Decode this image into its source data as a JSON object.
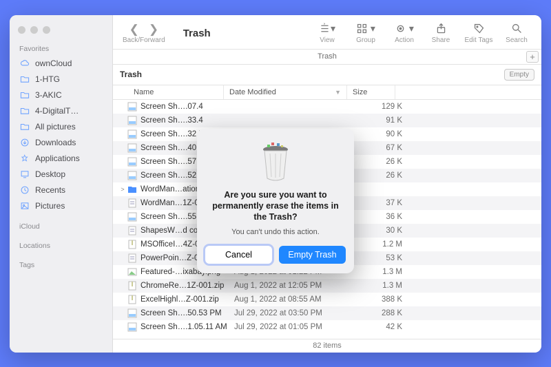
{
  "window": {
    "title": "Trash",
    "nav_label": "Back/Forward",
    "subheader": "Trash",
    "location": "Trash",
    "empty_button": "Empty",
    "status": "82 items",
    "plus": "+"
  },
  "toolbar": {
    "view": {
      "label": "View"
    },
    "group": {
      "label": "Group"
    },
    "action": {
      "label": "Action"
    },
    "share": {
      "label": "Share"
    },
    "tags": {
      "label": "Edit Tags"
    },
    "search": {
      "label": "Search"
    }
  },
  "sidebar": {
    "favorites_label": "Favorites",
    "icloud_label": "iCloud",
    "locations_label": "Locations",
    "tags_label": "Tags",
    "items": [
      {
        "label": "ownCloud",
        "icon": "cloud"
      },
      {
        "label": "1-HTG",
        "icon": "folder"
      },
      {
        "label": "3-AKIC",
        "icon": "folder"
      },
      {
        "label": "4-DigitalT…",
        "icon": "folder"
      },
      {
        "label": "All pictures",
        "icon": "folder"
      },
      {
        "label": "Downloads",
        "icon": "download"
      },
      {
        "label": "Applications",
        "icon": "apps"
      },
      {
        "label": "Desktop",
        "icon": "desktop"
      },
      {
        "label": "Recents",
        "icon": "clock"
      },
      {
        "label": "Pictures",
        "icon": "picture"
      }
    ]
  },
  "columns": {
    "name": "Name",
    "date": "Date Modified",
    "size": "Size"
  },
  "rows": [
    {
      "name": "Screen Sh….07.4",
      "date": "",
      "size": "129 K",
      "icon": "png",
      "exp": ""
    },
    {
      "name": "Screen Sh….33.4",
      "date": "",
      "size": "91 K",
      "icon": "png",
      "exp": ""
    },
    {
      "name": "Screen Sh….32.5",
      "date": "",
      "size": "90 K",
      "icon": "png",
      "exp": ""
    },
    {
      "name": "Screen Sh….40.0",
      "date": "",
      "size": "67 K",
      "icon": "png",
      "exp": ""
    },
    {
      "name": "Screen Sh….57.0",
      "date": "",
      "size": "26 K",
      "icon": "png",
      "exp": ""
    },
    {
      "name": "Screen Sh….52.4",
      "date": "",
      "size": "26 K",
      "icon": "png",
      "exp": ""
    },
    {
      "name": "WordMan…ation",
      "date": "",
      "size": "",
      "icon": "folder",
      "exp": ">"
    },
    {
      "name": "WordMan…1Z-0",
      "date": "",
      "size": "37 K",
      "icon": "doc",
      "exp": ""
    },
    {
      "name": "Screen Sh….55.0",
      "date": "",
      "size": "36 K",
      "icon": "png",
      "exp": ""
    },
    {
      "name": "ShapesW…d cop",
      "date": "",
      "size": "30 K",
      "icon": "doc",
      "exp": ""
    },
    {
      "name": "MSOfficeI…4Z-0",
      "date": "",
      "size": "1.2 M",
      "icon": "zip",
      "exp": ""
    },
    {
      "name": "PowerPoin…Z-0",
      "date": "",
      "size": "53 K",
      "icon": "doc",
      "exp": ""
    },
    {
      "name": "Featured-…ixabay.png",
      "date": "Aug 1, 2022 at 01:22 PM",
      "size": "1.3 M",
      "icon": "img",
      "exp": ""
    },
    {
      "name": "ChromeRe…1Z-001.zip",
      "date": "Aug 1, 2022 at 12:05 PM",
      "size": "1.3 M",
      "icon": "zip",
      "exp": ""
    },
    {
      "name": "ExcelHighl…Z-001.zip",
      "date": "Aug 1, 2022 at 08:55 AM",
      "size": "388 K",
      "icon": "zip",
      "exp": ""
    },
    {
      "name": "Screen Sh….50.53 PM",
      "date": "Jul 29, 2022 at 03:50 PM",
      "size": "288 K",
      "icon": "png",
      "exp": ""
    },
    {
      "name": "Screen Sh….1.05.11 AM",
      "date": "Jul 29, 2022 at 01:05 PM",
      "size": "42 K",
      "icon": "png",
      "exp": ""
    }
  ],
  "dialog": {
    "message": "Are you sure you want to permanently erase the items in the Trash?",
    "sub": "You can't undo this action.",
    "cancel": "Cancel",
    "empty": "Empty Trash"
  }
}
